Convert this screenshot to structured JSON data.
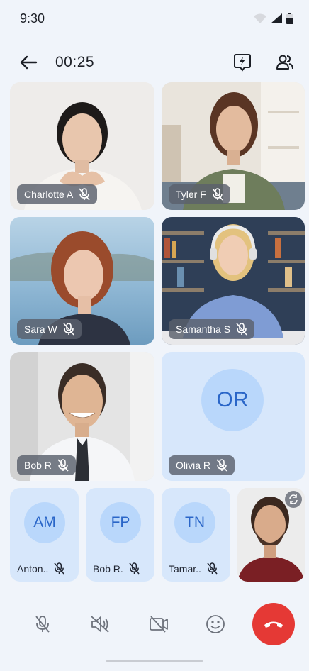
{
  "status_bar": {
    "time": "9:30"
  },
  "top_bar": {
    "timer": "00:25"
  },
  "participants": [
    {
      "name": "Charlotte A"
    },
    {
      "name": "Tyler F"
    },
    {
      "name": "Sara W"
    },
    {
      "name": "Samantha S"
    },
    {
      "name": "Bob R"
    },
    {
      "name": "Olivia R",
      "initials": "OR"
    }
  ],
  "mini_participants": [
    {
      "initials": "AM",
      "name": "Anton.."
    },
    {
      "initials": "FP",
      "name": "Bob R."
    },
    {
      "initials": "TN",
      "name": "Tamar.."
    }
  ],
  "colors": {
    "background": "#f0f4fa",
    "tile": "#d7e7fb",
    "avatar_circle": "#b9d7fb",
    "avatar_text": "#2a66c8",
    "end_call": "#e53935"
  },
  "icons": {
    "back": "arrow-left-icon",
    "flash": "flash-icon",
    "participants": "participants-icon",
    "mic_off": "mic-off-icon",
    "speaker_off": "speaker-off-icon",
    "video_off": "video-off-icon",
    "emoji": "emoji-icon",
    "end_call": "phone-hangup-icon",
    "switch_camera": "switch-camera-icon"
  }
}
